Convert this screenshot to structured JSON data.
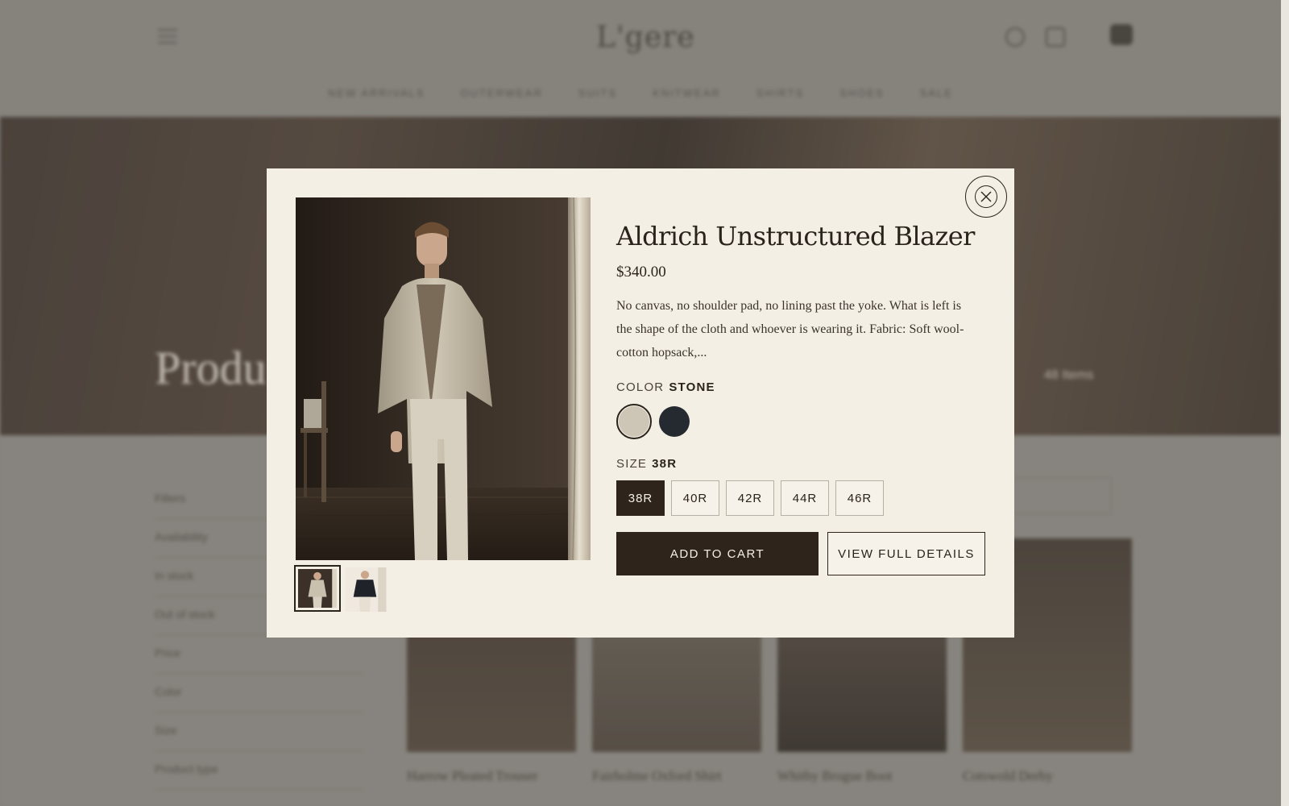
{
  "product": {
    "title": "Aldrich Unstructured Blazer",
    "price": "$340.00",
    "description": "No canvas, no shoulder pad, no lining past the yoke. What is left is the shape of the cloth and whoever is wearing it. Fabric: Soft wool-cotton hopsack,...",
    "color_label": "COLOR",
    "selected_color": "STONE",
    "colors": [
      {
        "name": "stone",
        "hex": "#cdc5b6",
        "selected": true
      },
      {
        "name": "navy",
        "hex": "#252a30",
        "selected": false
      }
    ],
    "size_label": "SIZE",
    "selected_size": "38R",
    "sizes": [
      "38R",
      "40R",
      "42R",
      "44R",
      "46R"
    ],
    "add_to_cart": "ADD TO CART",
    "view_details": "VIEW FULL DETAILS",
    "thumbnails": [
      "stone-blazer-front",
      "navy-blazer-front"
    ]
  },
  "colors": {
    "accent_dark": "#2e241b",
    "modal_bg": "#f4efe5"
  }
}
